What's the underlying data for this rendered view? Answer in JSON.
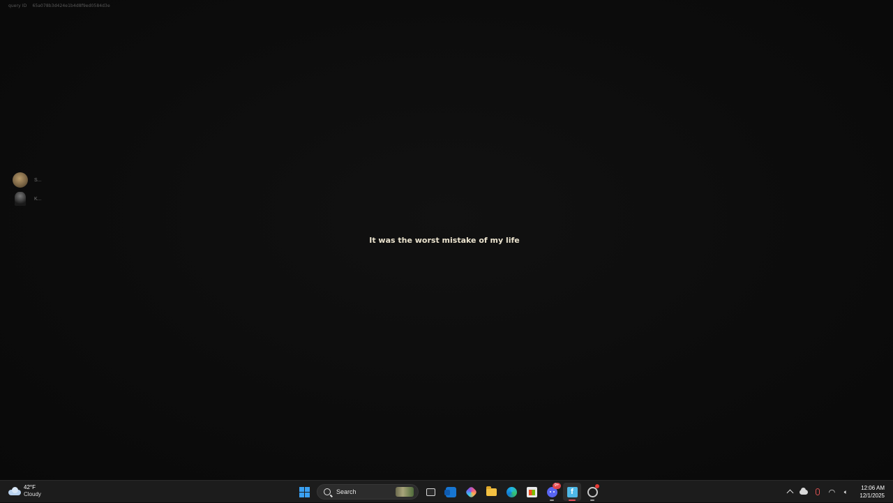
{
  "overlay": {
    "debug_label": "query ID",
    "debug_value": "65a078b3d424e1b4d8f9ed0584d3e"
  },
  "participants": [
    {
      "name": "S...",
      "avatar": "avatar-1"
    },
    {
      "name": "K...",
      "avatar": "avatar-2"
    }
  ],
  "subtitle": "It was the worst mistake of my life",
  "taskbar": {
    "weather": {
      "temp": "42°F",
      "condition": "Cloudy",
      "icon": "cloud-icon"
    },
    "search_placeholder": "Search",
    "apps": [
      {
        "name": "task-view",
        "icon": "task-view-icon"
      },
      {
        "name": "outlook",
        "icon": "outlook-icon"
      },
      {
        "name": "copilot",
        "icon": "copilot-icon"
      },
      {
        "name": "file-explorer",
        "icon": "folder-icon"
      },
      {
        "name": "edge",
        "icon": "edge-icon"
      },
      {
        "name": "microsoft-store",
        "icon": "store-icon"
      },
      {
        "name": "discord",
        "icon": "discord-icon",
        "badge": "9+"
      },
      {
        "name": "app-f",
        "icon": "app-f-icon",
        "label": "f"
      },
      {
        "name": "app-circle",
        "icon": "circle-app-icon"
      }
    ],
    "clock": {
      "time": "12:06 AM",
      "date": "12/1/2025"
    }
  },
  "colors": {
    "background": "#0b0b0b",
    "subtitle": "#ece4cf",
    "taskbar": "#1c1c1c",
    "accent_red": "#e8505b",
    "windows_blue": "#3aa0f2"
  }
}
